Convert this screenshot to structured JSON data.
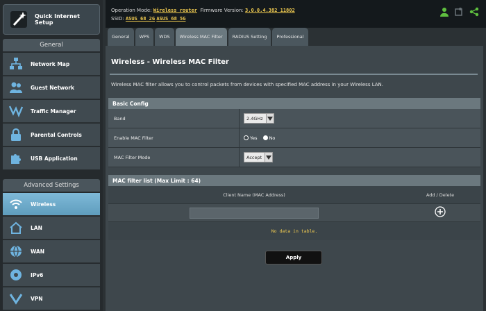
{
  "sidebar": {
    "quick_setup": "Quick Internet Setup",
    "general_header": "General",
    "general_items": [
      {
        "label": "Network Map",
        "icon": "network-map-icon"
      },
      {
        "label": "Guest Network",
        "icon": "guest-network-icon"
      },
      {
        "label": "Traffic Manager",
        "icon": "traffic-manager-icon"
      },
      {
        "label": "Parental Controls",
        "icon": "lock-icon"
      },
      {
        "label": "USB Application",
        "icon": "puzzle-icon"
      }
    ],
    "advanced_header": "Advanced Settings",
    "advanced_items": [
      {
        "label": "Wireless",
        "icon": "wireless-icon"
      },
      {
        "label": "LAN",
        "icon": "home-icon"
      },
      {
        "label": "WAN",
        "icon": "globe-icon"
      },
      {
        "label": "IPv6",
        "icon": "ipv6-icon"
      },
      {
        "label": "VPN",
        "icon": "vpn-icon"
      }
    ]
  },
  "topbar": {
    "op_mode_label": "Operation Mode:",
    "op_mode_value": "Wireless router",
    "fw_label": "Firmware Version:",
    "fw_value": "3.0.0.4.382_11802",
    "ssid_label": "SSID:",
    "ssid_1": "ASUS_68_2G",
    "ssid_2": "ASUS_68_5G"
  },
  "tabs": [
    "General",
    "WPS",
    "WDS",
    "Wireless MAC Filter",
    "RADIUS Setting",
    "Professional"
  ],
  "content": {
    "title": "Wireless - Wireless MAC Filter",
    "description": "Wireless MAC filter allows you to control packets from devices with specified MAC address in your Wireless LAN.",
    "basic_config_header": "Basic Config",
    "band_label": "Band",
    "band_value": "2.4GHz",
    "enable_label": "Enable MAC Filter",
    "yes_label": "Yes",
    "no_label": "No",
    "mode_label": "MAC Filter Mode",
    "mode_value": "Accept",
    "list_header": "MAC filter list (Max Limit : 64)",
    "col_client": "Client Name (MAC Address)",
    "col_add": "Add / Delete",
    "no_data": "No data in table.",
    "apply": "Apply"
  },
  "colors": {
    "accent": "#f2cc51",
    "active": "#6aa8c8",
    "status_green": "#5fbf3f"
  }
}
